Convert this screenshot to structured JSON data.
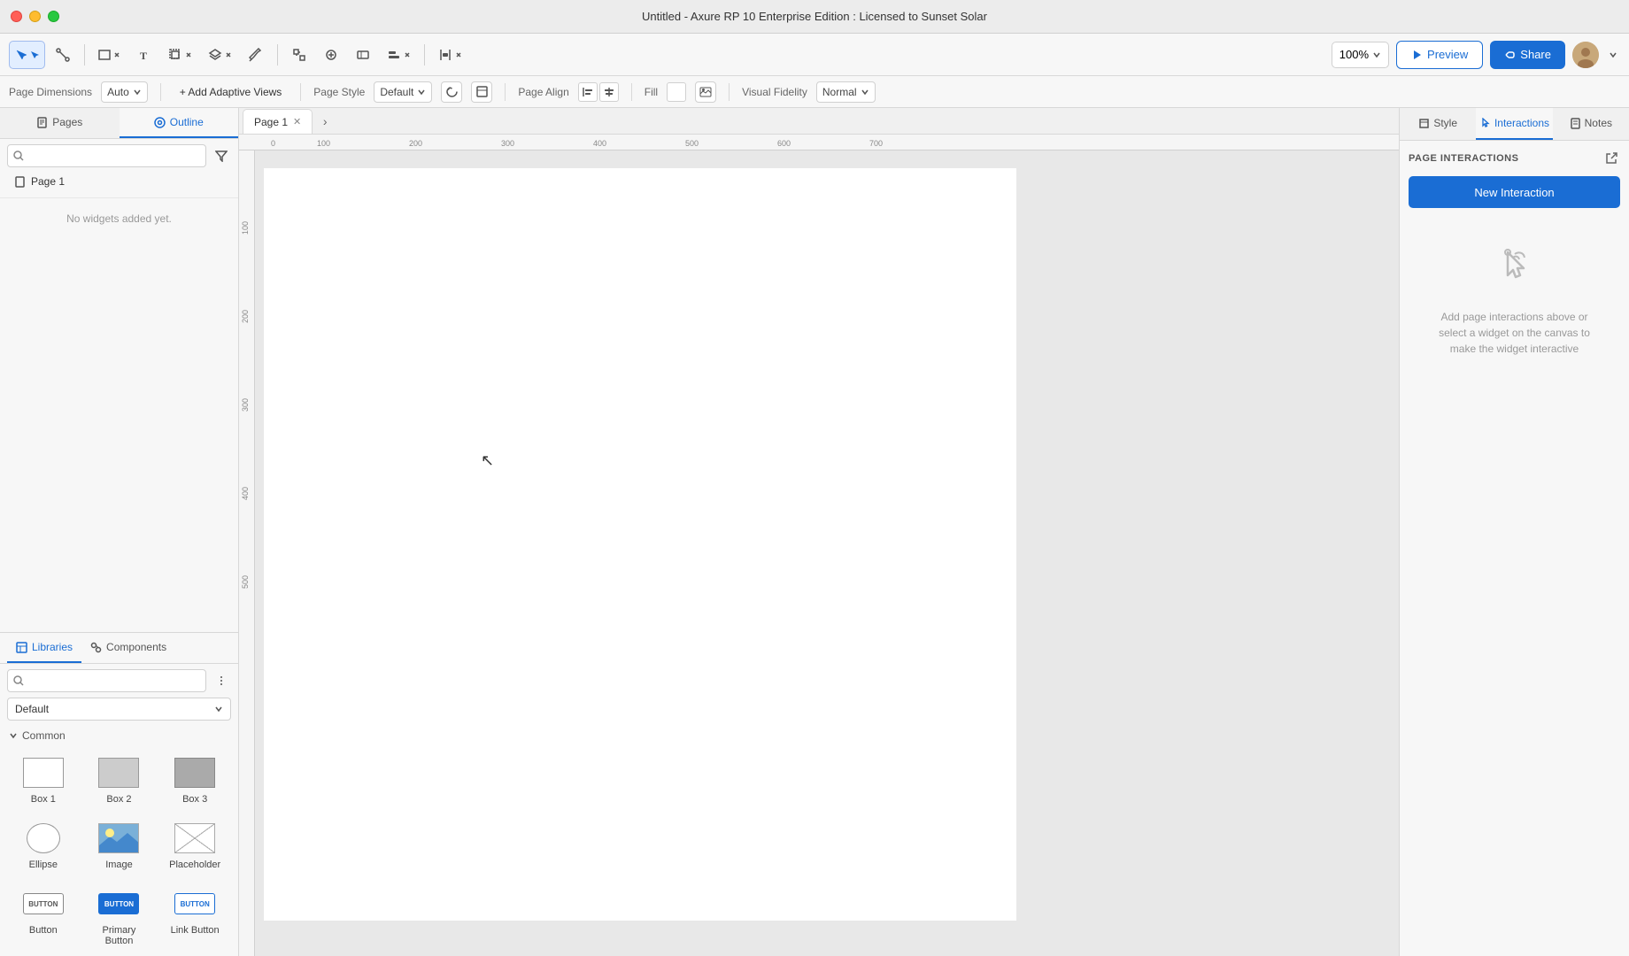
{
  "app": {
    "title": "Untitled - Axure RP 10 Enterprise Edition : Licensed to Sunset Solar"
  },
  "titlebar": {
    "title": "Untitled - Axure RP 10 Enterprise Edition : Licensed to Sunset Solar"
  },
  "toolbar": {
    "zoom_label": "100%",
    "preview_label": "Preview",
    "share_label": "Share"
  },
  "page_props": {
    "dimensions_label": "Page Dimensions",
    "dimensions_value": "Auto",
    "add_adaptive_label": "+ Add Adaptive Views",
    "page_style_label": "Page Style",
    "page_style_value": "Default",
    "page_align_label": "Page Align",
    "fill_label": "Fill",
    "visual_fidelity_label": "Visual Fidelity",
    "visual_fidelity_value": "Normal"
  },
  "left_panel": {
    "pages_tab": "Pages",
    "outline_tab": "Outline",
    "pages": [
      {
        "name": "Page 1"
      }
    ],
    "outline_empty": "No widgets added yet."
  },
  "libraries": {
    "libraries_tab": "Libraries",
    "components_tab": "Components",
    "default_lib": "Default",
    "common_section": "Common",
    "widgets": [
      {
        "label": "Box 1",
        "type": "box1"
      },
      {
        "label": "Box 2",
        "type": "box2"
      },
      {
        "label": "Box 3",
        "type": "box3"
      },
      {
        "label": "Ellipse",
        "type": "ellipse"
      },
      {
        "label": "Image",
        "type": "image"
      },
      {
        "label": "Placeholder",
        "type": "placeholder"
      },
      {
        "label": "Button",
        "type": "button"
      },
      {
        "label": "Primary Button",
        "type": "primary-button"
      },
      {
        "label": "Link Button",
        "type": "link-button"
      }
    ]
  },
  "tabs": [
    {
      "label": "Page 1"
    }
  ],
  "right_panel": {
    "style_tab": "Style",
    "interactions_tab": "Interactions",
    "notes_tab": "Notes",
    "page_interactions_title": "PAGE INTERACTIONS",
    "new_interaction_label": "New Interaction",
    "empty_message": "Add page interactions above or select a widget on the canvas to make the widget interactive"
  }
}
